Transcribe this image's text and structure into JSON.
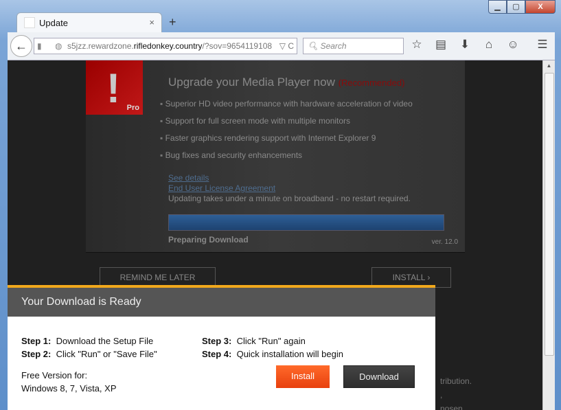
{
  "window": {
    "minimize": "▁",
    "maximize": "▢",
    "close": "X"
  },
  "tab": {
    "title": "Update",
    "close": "×",
    "new_tab": "+"
  },
  "nav": {
    "back": "←",
    "url_prefix": "s5jzz.rewardzone.",
    "url_domain": "rifledonkey.country",
    "url_suffix": "/?sov=9654119108",
    "url_tail": "▽ C",
    "search_placeholder": "Search",
    "search_icon": "🔍︎"
  },
  "toolbar": {
    "icons": [
      "star-icon",
      "reading-list-icon",
      "download-icon",
      "home-icon",
      "hello-icon",
      "menu-icon"
    ],
    "glyphs": [
      "☆",
      "▤",
      "⬇",
      "⌂",
      "☺",
      "☰"
    ]
  },
  "page": {
    "pro_label": "Pro",
    "exclaim": "!",
    "headline": "Upgrade your Media Player now",
    "recommended": "(Recommended)",
    "features": [
      "Superior HD video performance with hardware acceleration of video",
      "Support for full screen mode with multiple monitors",
      "Faster graphics rendering support with Internet Explorer 9",
      "Bug fixes and security enhancements"
    ],
    "see_details": "See details",
    "eula": "End User License Agreement",
    "note": "Updating takes under a minute on broadband - no restart required.",
    "progress_percent": 100,
    "preparing": "Preparing Download",
    "version": "ver. 12.0",
    "remind": "REMIND ME LATER",
    "install": "INSTALL ›",
    "behind_text": [
      "tribution.",
      ",",
      "nosen"
    ]
  },
  "popup": {
    "title": "Your Download is Ready",
    "steps": [
      {
        "label": "Step 1:",
        "text": "Download the Setup File"
      },
      {
        "label": "Step 2:",
        "text": "Click \"Run\" or \"Save File\""
      },
      {
        "label": "Step 3:",
        "text": "Click \"Run\" again"
      },
      {
        "label": "Step 4:",
        "text": "Quick installation will begin"
      }
    ],
    "free_line1": "Free Version for:",
    "free_line2": "Windows 8, 7, Vista, XP",
    "install": "Install",
    "download": "Download",
    "colors": {
      "accent": "#f1a81c",
      "install": "#f0501c",
      "download": "#3a3a3a"
    }
  }
}
